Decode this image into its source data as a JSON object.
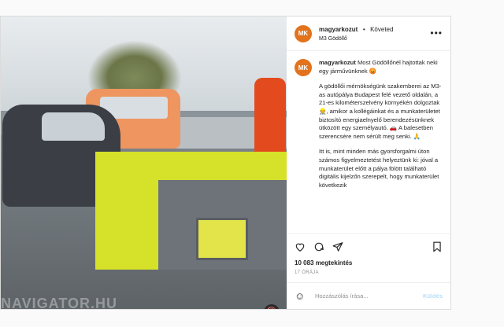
{
  "account": {
    "username": "magyarkozut",
    "follow_label": "Követed",
    "location": "M3 Gödöllő",
    "logo_text": "MK"
  },
  "caption": {
    "username": "magyarkozut",
    "paragraphs": [
      "Most Gödöllőnél hajtottak neki egy járművünknek 😡",
      "A gödöllői mérnökségünk szakemberei az M3-as autópálya Budapest felé vezető oldalán, a 21-es kilométerszelvény környékén dolgoztak 👷, amikor a kollégáinkat és a munkaterületet biztosító energiaelnyelő berendezésünknek ütközött egy személyautó. 🚗 A balesetben szerencsére nem sérült meg senki. 🙏",
      "Itt is, mint minden más gyorsforgalmi úton számos figyelmeztetést helyeztünk ki: jóval a munkaterület előtt a pálya fölött található digitális kijelzőn szerepelt, hogy munkaterület következik"
    ]
  },
  "likes": "10 083 megtekintés",
  "time": "17 ÓRÁJA",
  "comment": {
    "placeholder": "Hozzászólás írása...",
    "send_label": "Küldés"
  },
  "media": {
    "watermark": "NAVIGATOR.HU"
  },
  "colors": {
    "brand": "#e2731c",
    "send": "#b2dffc"
  }
}
